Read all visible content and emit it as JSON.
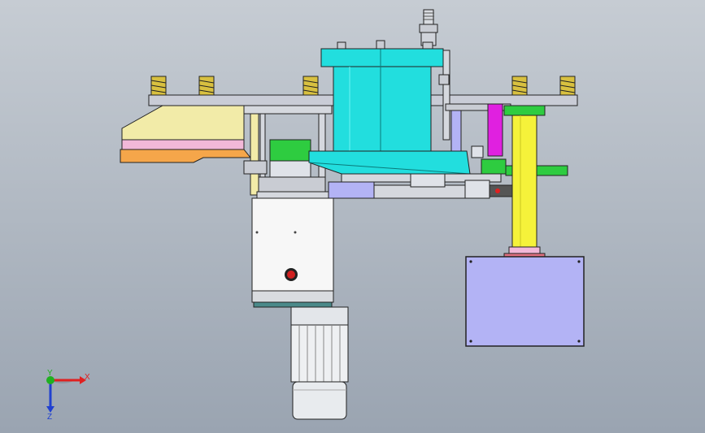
{
  "triad": {
    "x_label": "X",
    "y_label": "Y",
    "z_label": "Z",
    "x_color": "#e02020",
    "y_color": "#20b020",
    "z_color": "#2040d0"
  },
  "colors": {
    "background_top": "#c6ccd3",
    "background_bottom": "#9aa4b1",
    "cylinder": "#22dede",
    "top_plate": "#c9ccd6",
    "hopper": "#f2eba8",
    "pink_band": "#f2b8d8",
    "orange_plate": "#f5a64a",
    "yellow_column": "#f5f23a",
    "motor_box": "#b3b3f5",
    "green_block": "#2ecc40",
    "magenta": "#e020e0",
    "spring": "#d8c040"
  },
  "icons": [
    "spring-icon",
    "red-button-icon",
    "motor-icon",
    "axis-triad-icon"
  ]
}
